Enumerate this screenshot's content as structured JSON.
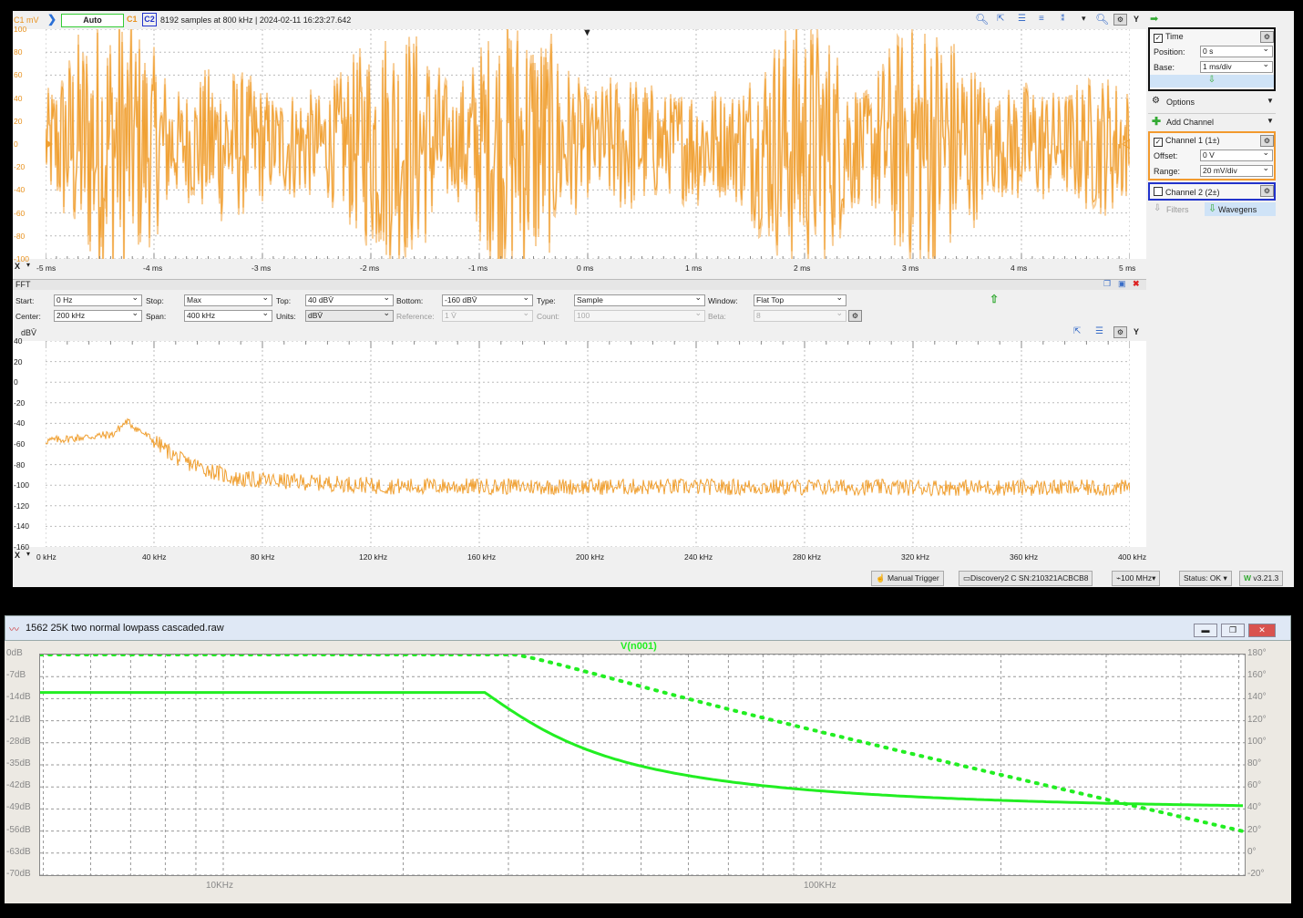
{
  "waveforms": {
    "toolbar": {
      "scale_hint": "C1 mV",
      "auto_button": "Auto",
      "c1": "C1",
      "c2": "C2",
      "acquisition": "8192 samples at 800 kHz  | 2024-02-11 16:23:27.642",
      "y_button": "Y"
    },
    "time_plot": {
      "y_ticks": [
        "100",
        "80",
        "60",
        "40",
        "20",
        "0",
        "-20",
        "-40",
        "-60",
        "-80",
        "-100"
      ],
      "x_ticks": [
        "-5 ms",
        "-4 ms",
        "-3 ms",
        "-2 ms",
        "-1 ms",
        "0 ms",
        "1 ms",
        "2 ms",
        "3 ms",
        "4 ms",
        "5 ms"
      ],
      "x_axis_button": "X"
    },
    "fft": {
      "title": "FFT",
      "start_label": "Start:",
      "start_value": "0 Hz",
      "stop_label": "Stop:",
      "stop_value": "Max",
      "top_label": "Top:",
      "top_value": "40 dBV̄",
      "bottom_label": "Bottom:",
      "bottom_value": "-160 dBV̄",
      "type_label": "Type:",
      "type_value": "Sample",
      "window_label": "Window:",
      "window_value": "Flat Top",
      "center_label": "Center:",
      "center_value": "200 kHz",
      "span_label": "Span:",
      "span_value": "400 kHz",
      "units_label": "Units:",
      "units_value": "dBV̄",
      "reference_label": "Reference:",
      "reference_value": "1 V̄",
      "count_label": "Count:",
      "count_value": "100",
      "beta_label": "Beta:",
      "beta_value": "8",
      "unit": "dBV̄",
      "y_ticks": [
        "40",
        "20",
        "0",
        "-20",
        "-40",
        "-60",
        "-80",
        "-100",
        "-120",
        "-140",
        "-160"
      ],
      "x_ticks": [
        "0 kHz",
        "40 kHz",
        "80 kHz",
        "120 kHz",
        "160 kHz",
        "200 kHz",
        "240 kHz",
        "280 kHz",
        "320 kHz",
        "360 kHz",
        "400 kHz"
      ],
      "x_axis_button": "X",
      "y_button": "Y"
    },
    "sidebar": {
      "time": {
        "label": "Time",
        "position_label": "Position:",
        "position_value": "0 s",
        "base_label": "Base:",
        "base_value": "1 ms/div"
      },
      "options": "Options",
      "add_channel": "Add Channel",
      "channel1": {
        "label": "Channel 1 (1±)",
        "offset_label": "Offset:",
        "offset_value": "0 V",
        "range_label": "Range:",
        "range_value": "20 mV/div"
      },
      "channel2": {
        "label": "Channel 2 (2±)"
      },
      "filters": "Filters",
      "wavegens": "Wavegens"
    },
    "status_bar": {
      "manual_trigger": "Manual Trigger",
      "device": "Discovery2 C SN:210321ACBCB8",
      "clock": "100 MHz",
      "status": "Status: OK",
      "version": "v3.21.3"
    },
    "colors": {
      "trace": "#f0a032",
      "trace_light": "#f8cf9a",
      "c1": "#e89321",
      "c2": "#2233cc"
    }
  },
  "ltspice": {
    "title": "1562 25K two normal lowpass cascaded.raw",
    "trace_name": "V(n001)",
    "y_left_ticks": [
      "0dB",
      "-7dB",
      "-14dB",
      "-21dB",
      "-28dB",
      "-35dB",
      "-42dB",
      "-49dB",
      "-56dB",
      "-63dB",
      "-70dB"
    ],
    "y_right_ticks": [
      "180°",
      "160°",
      "140°",
      "120°",
      "100°",
      "80°",
      "60°",
      "40°",
      "20°",
      "0°",
      "-20°"
    ],
    "x_ticks": [
      "10KHz",
      "100KHz"
    ],
    "colors": {
      "trace": "#22ee22"
    }
  }
}
